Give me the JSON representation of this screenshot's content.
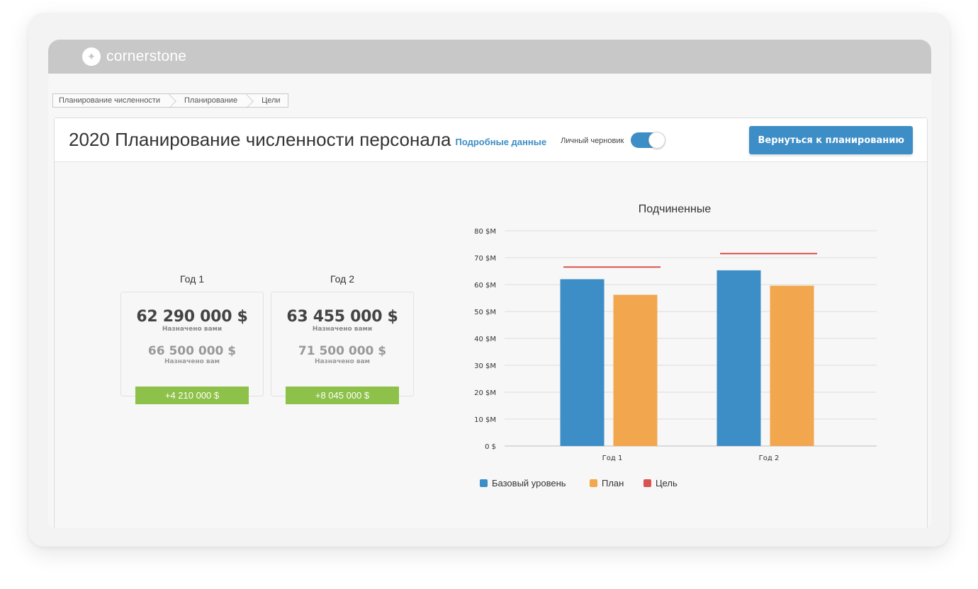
{
  "app": {
    "logo_text": "cornerstone",
    "logo_icon": "sparkle-icon"
  },
  "breadcrumb": [
    "Планирование численности",
    "Планирование",
    "Цели"
  ],
  "header": {
    "title": "2020 Планирование численности персонала",
    "details_link": "Подробные данные",
    "draft_label": "Личный черновик",
    "draft_toggle_on": true,
    "back_button": "Вернуться к планированию"
  },
  "years": [
    {
      "label": "Год 1",
      "assigned": "62 290 000 $",
      "assigned_label": "Назначено вами",
      "target": "66 500 000 $",
      "target_label": "Назначено вам",
      "diff": "+4 210 000 $"
    },
    {
      "label": "Год 2",
      "assigned": "63 455 000 $",
      "assigned_label": "Назначено вами",
      "target": "71 500 000 $",
      "target_label": "Назначено вам",
      "diff": "+8 045 000 $"
    }
  ],
  "colors": {
    "accent": "#3d8dc6",
    "base": "#3d8dc6",
    "plan": "#f2a64e",
    "goal": "#d9534f",
    "diff_badge": "#8dc14a"
  },
  "chart_data": {
    "type": "bar",
    "title": "Подчиненные",
    "categories": [
      "Год 1",
      "Год 2"
    ],
    "series": [
      {
        "name": "Базовый уровень",
        "values": [
          62,
          65.3
        ]
      },
      {
        "name": "План",
        "values": [
          56.2,
          59.6
        ]
      }
    ],
    "target_lines": {
      "name": "Цель",
      "values": [
        66.5,
        71.5
      ]
    },
    "y_ticks": [
      "0 $",
      "10 $M",
      "20 $M",
      "30 $M",
      "40 $M",
      "50 $M",
      "60 $M",
      "70 $M",
      "80 $M"
    ],
    "ylim": [
      0,
      80
    ],
    "grid": true,
    "legend": "bottom",
    "legend_items": [
      "Базовый уровень",
      "План",
      "Цель"
    ]
  }
}
